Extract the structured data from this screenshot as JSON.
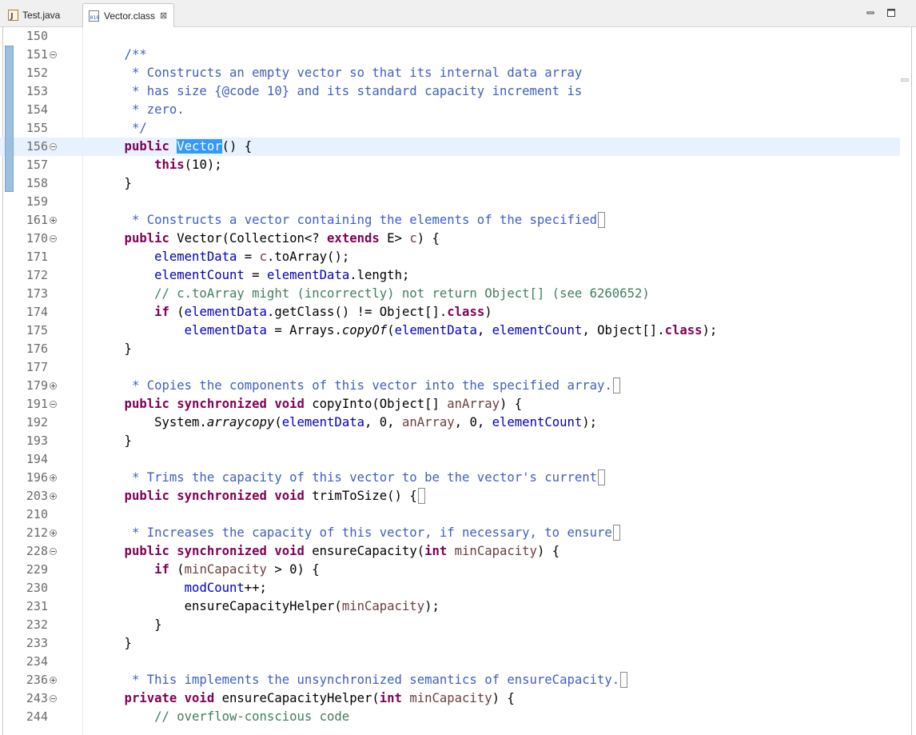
{
  "tabs": [
    {
      "label": "Test.java",
      "icon": "java-file-icon",
      "active": false
    },
    {
      "label": "Vector.class",
      "icon": "class-file-icon",
      "active": true,
      "close": "⊠"
    }
  ],
  "window_controls": {
    "minimize": "minimize-icon",
    "maximize": "maximize-icon"
  },
  "colors": {
    "keyword": "#7f0055",
    "javadoc": "#3f5fbf",
    "comment": "#3f7f5f",
    "field": "#0000c0",
    "parameter": "#6a3e3e",
    "current_line": "#e8f2fe",
    "selection": "#3399ff"
  },
  "editor": {
    "lines": [
      {
        "n": "150",
        "fold": "",
        "t": []
      },
      {
        "n": "151",
        "fold": "expanded",
        "t": [
          [
            "jd",
            "    /**"
          ]
        ]
      },
      {
        "n": "152",
        "fold": "",
        "t": [
          [
            "jd",
            "     * Constructs an empty vector so that its internal data array"
          ]
        ]
      },
      {
        "n": "153",
        "fold": "",
        "t": [
          [
            "jd",
            "     * has size {@code 10} and its standard capacity increment is"
          ]
        ]
      },
      {
        "n": "154",
        "fold": "",
        "t": [
          [
            "jd",
            "     * zero."
          ]
        ]
      },
      {
        "n": "155",
        "fold": "",
        "t": [
          [
            "jd",
            "     */"
          ]
        ]
      },
      {
        "n": "156",
        "fold": "expanded",
        "current": true,
        "t": [
          [
            "kw",
            "    public "
          ],
          [
            "sel",
            "Vector"
          ],
          [
            "",
            "() {"
          ]
        ]
      },
      {
        "n": "157",
        "fold": "",
        "t": [
          [
            "kw",
            "        this"
          ],
          [
            "",
            "(10);"
          ]
        ]
      },
      {
        "n": "158",
        "fold": "",
        "t": [
          [
            "",
            "    }"
          ]
        ]
      },
      {
        "n": "159",
        "fold": "",
        "t": []
      },
      {
        "n": "161",
        "fold": "collapsed",
        "t": [
          [
            "jd",
            "     * Constructs a vector containing the elements of the specified"
          ],
          [
            "elide",
            ""
          ]
        ]
      },
      {
        "n": "170",
        "fold": "expanded",
        "t": [
          [
            "kw",
            "    public "
          ],
          [
            "",
            "Vector(Collection<? "
          ],
          [
            "kw",
            "extends"
          ],
          [
            "",
            " E> "
          ],
          [
            "par",
            "c"
          ],
          [
            "",
            ") {"
          ]
        ]
      },
      {
        "n": "171",
        "fold": "",
        "t": [
          [
            "",
            "        "
          ],
          [
            "fld",
            "elementData"
          ],
          [
            "",
            " = "
          ],
          [
            "par",
            "c"
          ],
          [
            "",
            ".toArray();"
          ]
        ]
      },
      {
        "n": "172",
        "fold": "",
        "t": [
          [
            "",
            "        "
          ],
          [
            "fld",
            "elementCount"
          ],
          [
            "",
            " = "
          ],
          [
            "fld",
            "elementData"
          ],
          [
            "",
            ".length;"
          ]
        ]
      },
      {
        "n": "173",
        "fold": "",
        "t": [
          [
            "cm",
            "        // c.toArray might (incorrectly) not return Object[] (see 6260652)"
          ]
        ]
      },
      {
        "n": "174",
        "fold": "",
        "t": [
          [
            "kw",
            "        if"
          ],
          [
            "",
            " ("
          ],
          [
            "fld",
            "elementData"
          ],
          [
            "",
            ".getClass() != Object[]."
          ],
          [
            "kw",
            "class"
          ],
          [
            "",
            ")"
          ]
        ]
      },
      {
        "n": "175",
        "fold": "",
        "t": [
          [
            "",
            "            "
          ],
          [
            "fld",
            "elementData"
          ],
          [
            "",
            " = Arrays."
          ],
          [
            "st",
            "copyOf"
          ],
          [
            "",
            "("
          ],
          [
            "fld",
            "elementData"
          ],
          [
            "",
            ", "
          ],
          [
            "fld",
            "elementCount"
          ],
          [
            "",
            ", Object[]."
          ],
          [
            "kw",
            "class"
          ],
          [
            "",
            ");"
          ]
        ]
      },
      {
        "n": "176",
        "fold": "",
        "t": [
          [
            "",
            "    }"
          ]
        ]
      },
      {
        "n": "177",
        "fold": "",
        "t": []
      },
      {
        "n": "179",
        "fold": "collapsed",
        "t": [
          [
            "jd",
            "     * Copies the components of this vector into the specified array."
          ],
          [
            "elide",
            ""
          ]
        ]
      },
      {
        "n": "191",
        "fold": "expanded",
        "t": [
          [
            "kw",
            "    public synchronized void "
          ],
          [
            "",
            "copyInto(Object[] "
          ],
          [
            "par",
            "anArray"
          ],
          [
            "",
            ") {"
          ]
        ]
      },
      {
        "n": "192",
        "fold": "",
        "t": [
          [
            "",
            "        System."
          ],
          [
            "st",
            "arraycopy"
          ],
          [
            "",
            "("
          ],
          [
            "fld",
            "elementData"
          ],
          [
            "",
            ", 0, "
          ],
          [
            "par",
            "anArray"
          ],
          [
            "",
            ", 0, "
          ],
          [
            "fld",
            "elementCount"
          ],
          [
            "",
            ");"
          ]
        ]
      },
      {
        "n": "193",
        "fold": "",
        "t": [
          [
            "",
            "    }"
          ]
        ]
      },
      {
        "n": "194",
        "fold": "",
        "t": []
      },
      {
        "n": "196",
        "fold": "collapsed",
        "t": [
          [
            "jd",
            "     * Trims the capacity of this vector to be the vector's current"
          ],
          [
            "elide",
            ""
          ]
        ]
      },
      {
        "n": "203",
        "fold": "collapsed",
        "t": [
          [
            "kw",
            "    public synchronized void "
          ],
          [
            "",
            "trimToSize() {"
          ],
          [
            "elide",
            ""
          ]
        ]
      },
      {
        "n": "210",
        "fold": "",
        "t": []
      },
      {
        "n": "212",
        "fold": "collapsed",
        "t": [
          [
            "jd",
            "     * Increases the capacity of this vector, if necessary, to ensure"
          ],
          [
            "elide",
            ""
          ]
        ]
      },
      {
        "n": "228",
        "fold": "expanded",
        "t": [
          [
            "kw",
            "    public synchronized void "
          ],
          [
            "",
            "ensureCapacity("
          ],
          [
            "kw",
            "int "
          ],
          [
            "par",
            "minCapacity"
          ],
          [
            "",
            ") {"
          ]
        ]
      },
      {
        "n": "229",
        "fold": "",
        "t": [
          [
            "kw",
            "        if"
          ],
          [
            "",
            " ("
          ],
          [
            "par",
            "minCapacity"
          ],
          [
            "",
            " > 0) {"
          ]
        ]
      },
      {
        "n": "230",
        "fold": "",
        "t": [
          [
            "",
            "            "
          ],
          [
            "fld",
            "modCount"
          ],
          [
            "",
            "++;"
          ]
        ]
      },
      {
        "n": "231",
        "fold": "",
        "t": [
          [
            "",
            "            ensureCapacityHelper("
          ],
          [
            "par",
            "minCapacity"
          ],
          [
            "",
            ");"
          ]
        ]
      },
      {
        "n": "232",
        "fold": "",
        "t": [
          [
            "",
            "        }"
          ]
        ]
      },
      {
        "n": "233",
        "fold": "",
        "t": [
          [
            "",
            "    }"
          ]
        ]
      },
      {
        "n": "234",
        "fold": "",
        "t": []
      },
      {
        "n": "236",
        "fold": "collapsed",
        "t": [
          [
            "jd",
            "     * This implements the unsynchronized semantics of ensureCapacity."
          ],
          [
            "elide",
            ""
          ]
        ]
      },
      {
        "n": "243",
        "fold": "expanded",
        "t": [
          [
            "kw",
            "    private void "
          ],
          [
            "",
            "ensureCapacityHelper("
          ],
          [
            "kw",
            "int "
          ],
          [
            "par",
            "minCapacity"
          ],
          [
            "",
            ") {"
          ]
        ]
      },
      {
        "n": "244",
        "fold": "",
        "t": [
          [
            "cm",
            "        // overflow-conscious code"
          ]
        ]
      }
    ]
  }
}
